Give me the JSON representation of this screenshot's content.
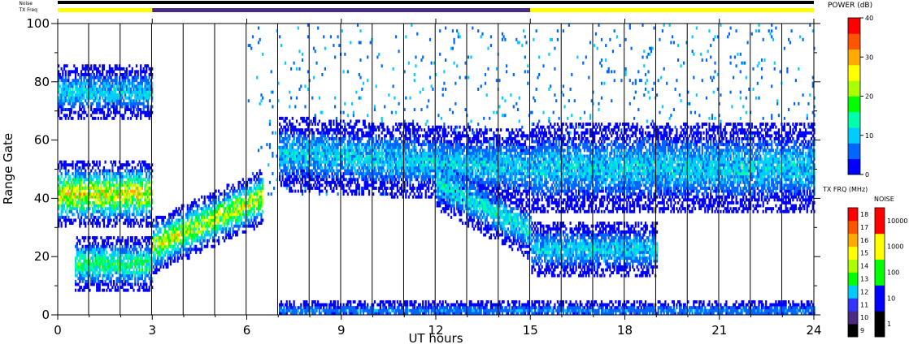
{
  "header": {
    "noise_label": "Noise",
    "txfreq_label": "TX Freq",
    "txfreq_segments": [
      {
        "from": 0,
        "to": 3,
        "color": "#ffff00"
      },
      {
        "from": 3,
        "to": 15,
        "color": "#4b2a84"
      },
      {
        "from": 15,
        "to": 24,
        "color": "#ffff00"
      }
    ],
    "noise_color": "#000000"
  },
  "chart_data": {
    "type": "heatmap",
    "title": "",
    "xlabel": "UT hours",
    "ylabel": "Range Gate",
    "xlim": [
      0,
      24
    ],
    "ylim": [
      0,
      100
    ],
    "x_ticks": [
      "0",
      "3",
      "6",
      "9",
      "12",
      "15",
      "18",
      "21",
      "24"
    ],
    "x_tick_values": [
      0,
      3,
      6,
      9,
      12,
      15,
      18,
      21,
      24
    ],
    "y_ticks": [
      "0",
      "20",
      "40",
      "60",
      "80",
      "100"
    ],
    "y_tick_values": [
      0,
      20,
      40,
      60,
      80,
      100
    ],
    "scan_boundaries_hours": [
      0.98,
      1.98,
      2.98,
      3.98,
      4.98,
      5.98,
      6.98,
      7.98,
      8.98,
      9.98,
      10.98,
      11.98,
      12.98,
      13.98,
      14.98,
      15.98,
      16.98,
      17.98,
      18.98,
      19.98,
      20.98,
      21.98,
      22.98
    ],
    "features": [
      {
        "name": "strong band",
        "t_start": 0,
        "t_end": 3,
        "gate_center": 41,
        "gate_width": 7,
        "power_db": 28
      },
      {
        "name": "upper band",
        "t_start": 0,
        "t_end": 3,
        "gate_center": 76,
        "gate_width": 6,
        "power_db": 12
      },
      {
        "name": "lower band",
        "t_start": 0.5,
        "t_end": 3,
        "gate_center": 17,
        "gate_width": 6,
        "power_db": 18
      },
      {
        "name": "rising band",
        "t_start": 3,
        "t_end": 6.5,
        "gate_center_start": 23,
        "gate_center_end": 40,
        "gate_width": 6,
        "power_db": 26
      },
      {
        "name": "main echo",
        "t_start": 7,
        "t_end": 15,
        "gate_center_start": 55,
        "gate_center_end": 50,
        "gate_width": 8,
        "power_db": 12
      },
      {
        "name": "descending band",
        "t_start": 12,
        "t_end": 15,
        "gate_center_start": 45,
        "gate_center_end": 28,
        "gate_width": 6,
        "power_db": 14
      },
      {
        "name": "late band",
        "t_start": 15,
        "t_end": 24,
        "gate_center": 50,
        "gate_width": 10,
        "power_db": 12
      },
      {
        "name": "late lower band",
        "t_start": 15,
        "t_end": 19,
        "gate_center": 22,
        "gate_width": 6,
        "power_db": 12
      },
      {
        "name": "ground",
        "t_start": 7,
        "t_end": 24,
        "gate_center": 1,
        "gate_width": 2,
        "power_db": 8
      }
    ]
  },
  "power_scale": {
    "title": "POWER (dB)",
    "ticks": [
      "0",
      "10",
      "20",
      "30",
      "40"
    ],
    "min": 0,
    "max": 40,
    "colors": [
      "#0000ff",
      "#0066ff",
      "#00ccff",
      "#00ffaa",
      "#00ff00",
      "#aaff00",
      "#ffff00",
      "#ffaa00",
      "#ff5500",
      "#ff0000"
    ]
  },
  "txfreq_scale": {
    "title": "TX FRQ (MHz)",
    "ticks": [
      "9",
      "10",
      "11",
      "12",
      "13",
      "14",
      "15",
      "16",
      "17",
      "18"
    ],
    "colors": [
      "#000000",
      "#4b2a84",
      "#3333ff",
      "#00ccff",
      "#00ff00",
      "#aaff00",
      "#ffff00",
      "#ffaa00",
      "#ff5500",
      "#ff0000"
    ]
  },
  "noise_scale": {
    "title": "NOISE",
    "ticks": [
      "1",
      "10",
      "100",
      "1000",
      "10000"
    ],
    "colors": [
      "#000000",
      "#0000ff",
      "#00ff00",
      "#ffff00",
      "#ff0000"
    ]
  }
}
